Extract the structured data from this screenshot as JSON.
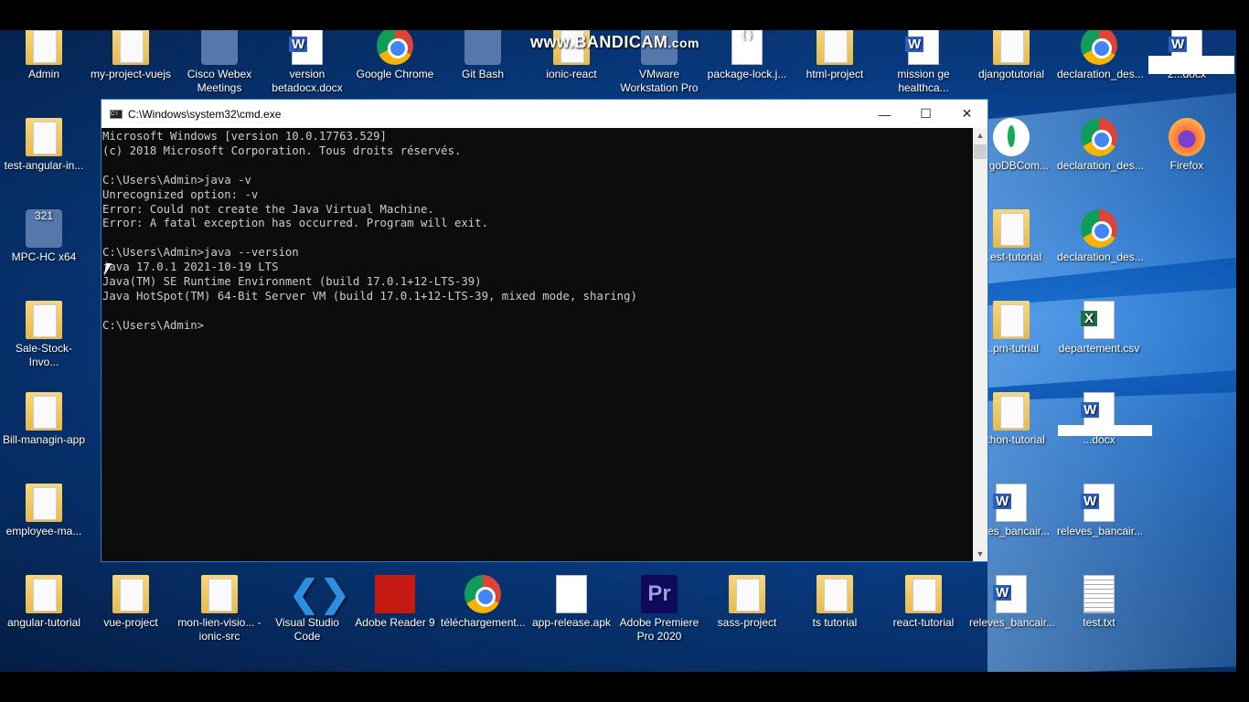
{
  "watermark": {
    "brand": "www.BANDICAM",
    "suffix": ".com"
  },
  "window": {
    "title": "C:\\Windows\\system32\\cmd.exe",
    "controls": {
      "minimize": "—",
      "maximize": "☐",
      "close": "✕"
    },
    "console_lines": [
      "Microsoft Windows [version 10.0.17763.529]",
      "(c) 2018 Microsoft Corporation. Tous droits réservés.",
      "",
      "C:\\Users\\Admin>java -v",
      "Unrecognized option: -v",
      "Error: Could not create the Java Virtual Machine.",
      "Error: A fatal exception has occurred. Program will exit.",
      "",
      "C:\\Users\\Admin>java --version",
      "java 17.0.1 2021-10-19 LTS",
      "Java(TM) SE Runtime Environment (build 17.0.1+12-LTS-39)",
      "Java HotSpot(TM) 64-Bit Server VM (build 17.0.1+12-LTS-39, mixed mode, sharing)",
      "",
      "C:\\Users\\Admin>"
    ]
  },
  "desktop_icons": [
    {
      "label": "Admin",
      "icon": "user-folder"
    },
    {
      "label": "my-project-vuejs",
      "icon": "folder"
    },
    {
      "label": "Cisco Webex Meetings",
      "icon": "webex"
    },
    {
      "label": "version betadocx.docx",
      "icon": "word"
    },
    {
      "label": "Google Chrome",
      "icon": "chrome"
    },
    {
      "label": "Git Bash",
      "icon": "git"
    },
    {
      "label": "ionic-react",
      "icon": "folder"
    },
    {
      "label": "VMware Workstation Pro",
      "icon": "vmware"
    },
    {
      "label": "package-lock.j...",
      "icon": "json"
    },
    {
      "label": "html-project",
      "icon": "folder"
    },
    {
      "label": "mission ge healthca...",
      "icon": "word"
    },
    {
      "label": "djangotutorial",
      "icon": "folder"
    },
    {
      "label": "declaration_des...",
      "icon": "chrome"
    },
    {
      "label": "2...docx",
      "icon": "word"
    },
    {
      "label": "test-angular-in...",
      "icon": "folder"
    },
    {
      "label": "...ngoDBCom...",
      "icon": "mongodb"
    },
    {
      "label": "declaration_des...",
      "icon": "chrome"
    },
    {
      "label": "Firefox",
      "icon": "firefox"
    },
    {
      "label": "MPC-HC x64",
      "icon": "mpc"
    },
    {
      "label": "...est-tutorial",
      "icon": "folder"
    },
    {
      "label": "declaration_des...",
      "icon": "chrome"
    },
    {
      "label": "Sale-Stock-Invo...",
      "icon": "folder"
    },
    {
      "label": "...pm-tutrial",
      "icon": "folder"
    },
    {
      "label": "departement.csv",
      "icon": "excel"
    },
    {
      "label": "Bill-managin-app",
      "icon": "folder"
    },
    {
      "label": "...thon-tutorial",
      "icon": "folder"
    },
    {
      "label": "...docx",
      "icon": "word"
    },
    {
      "label": "employee-ma...",
      "icon": "folder"
    },
    {
      "label": "...ves_bancair...",
      "icon": "word"
    },
    {
      "label": "releves_bancair...",
      "icon": "word"
    },
    {
      "label": "angular-tutorial",
      "icon": "folder"
    },
    {
      "label": "vue-project",
      "icon": "folder"
    },
    {
      "label": "mon-lien-visio... - ionic-src",
      "icon": "folder"
    },
    {
      "label": "Visual Studio Code",
      "icon": "vscode"
    },
    {
      "label": "Adobe Reader 9",
      "icon": "pdf"
    },
    {
      "label": "téléchargement...",
      "icon": "chrome"
    },
    {
      "label": "app-release.apk",
      "icon": "file"
    },
    {
      "label": "Adobe Premiere Pro 2020",
      "icon": "premiere"
    },
    {
      "label": "sass-project",
      "icon": "folder"
    },
    {
      "label": "ts tutorial",
      "icon": "folder"
    },
    {
      "label": "react-tutorial",
      "icon": "folder"
    },
    {
      "label": "releves_bancair...",
      "icon": "word"
    },
    {
      "label": "test.txt",
      "icon": "text"
    }
  ]
}
